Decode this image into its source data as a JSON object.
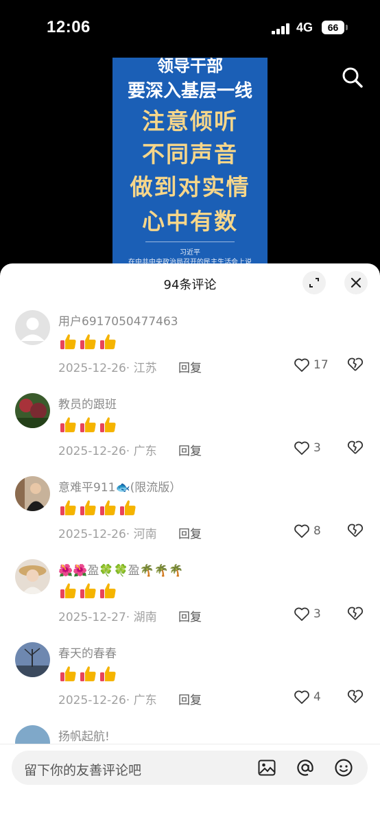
{
  "status_bar": {
    "time": "12:06",
    "network": "4G",
    "battery": "66"
  },
  "video": {
    "lines": [
      "领导干部",
      "要深入基层一线",
      "注意倾听",
      "不同声音",
      "做到对实情",
      "心中有数"
    ],
    "caption_author": "习近平",
    "caption_source": "在中共中央政治局召开的民主生活会上说"
  },
  "sheet": {
    "title": "94条评论"
  },
  "comments": [
    {
      "user": "用户6917050477463",
      "emojis": "👍👍👍",
      "thumbs": 3,
      "date": "2025-12-26",
      "location": "江苏",
      "reply": "回复",
      "likes": "17"
    },
    {
      "user": "教员的跟班",
      "emojis": "👍👍👍",
      "thumbs": 3,
      "date": "2025-12-26",
      "location": "广东",
      "reply": "回复",
      "likes": "3"
    },
    {
      "user": "意难平911🐟(限流版）",
      "emojis": "👍👍👍👍",
      "thumbs": 4,
      "date": "2025-12-26",
      "location": "河南",
      "reply": "回复",
      "likes": "8"
    },
    {
      "user": "🌺🌺盈🍀🍀盈🌴🌴🌴",
      "emojis": "👍👍👍",
      "thumbs": 3,
      "date": "2025-12-27",
      "location": "湖南",
      "reply": "回复",
      "likes": "3"
    },
    {
      "user": "春天的春春",
      "emojis": "👍👍👍",
      "thumbs": 3,
      "date": "2025-12-26",
      "location": "广东",
      "reply": "回复",
      "likes": "4"
    },
    {
      "user": "扬帆起航!",
      "emojis": "",
      "thumbs": 0,
      "date": "",
      "location": "",
      "reply": "",
      "likes": ""
    }
  ],
  "input": {
    "placeholder": "留下你的友善评论吧"
  },
  "icons": {
    "search": "search-icon",
    "expand": "expand-icon",
    "close": "close-icon",
    "like": "heart-icon",
    "dislike": "broken-heart-icon",
    "image": "image-icon",
    "mention": "at-icon",
    "emoji": "emoji-icon"
  },
  "colors": {
    "video_bg": "#1b5fb6",
    "headline_gold": "#f6d68a",
    "thumb": "#f5b400"
  }
}
